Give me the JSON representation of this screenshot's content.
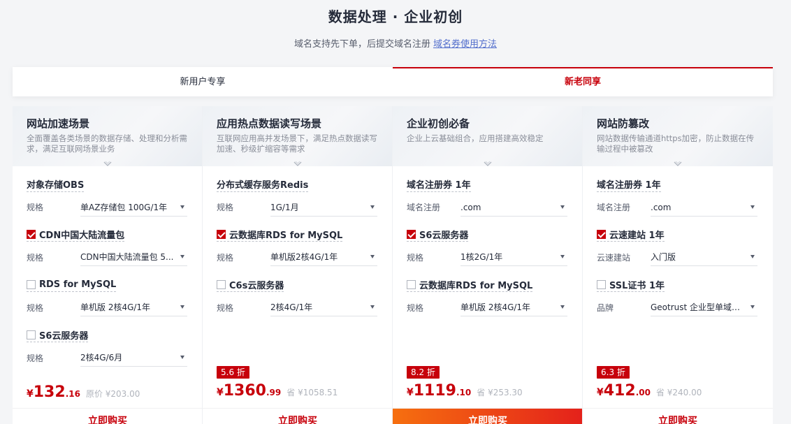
{
  "header": {
    "title": "数据处理 · 企业初创",
    "subtitle_text": "域名支持先下单，后提交域名注册",
    "subtitle_link": "域名券使用方法"
  },
  "tabs": [
    {
      "label": "新用户专享",
      "active": false
    },
    {
      "label": "新老同享",
      "active": true
    }
  ],
  "cards": [
    {
      "title": "网站加速场景",
      "desc": "全面覆盖各类场景的数据存储、处理和分析需求，满足互联网场景业务",
      "products": [
        {
          "name": "对象存储OBS",
          "checkbox": null,
          "spec_label": "规格",
          "spec_value": "单AZ存储包 100G/1年"
        },
        {
          "name": "CDN中国大陆流量包",
          "checkbox": true,
          "spec_label": "规格",
          "spec_value": "CDN中国大陆流量包 5..."
        },
        {
          "name": "RDS for MySQL",
          "checkbox": false,
          "spec_label": "规格",
          "spec_value": "单机版 2核4G/1年"
        },
        {
          "name": "S6云服务器",
          "checkbox": false,
          "spec_label": "规格",
          "spec_value": "2核4G/6月"
        }
      ],
      "discount": "",
      "price_symbol": "¥",
      "price_int": "132",
      "price_dec": ".16",
      "orig": "原价 ¥203.00",
      "buy": "立即购买",
      "buy_hot": false
    },
    {
      "title": "应用热点数据读写场景",
      "desc": "互联网应用高并发场景下，满足热点数据读写加速、秒级扩缩容等需求",
      "products": [
        {
          "name": "分布式缓存服务Redis",
          "checkbox": null,
          "spec_label": "规格",
          "spec_value": "1G/1月"
        },
        {
          "name": "云数据库RDS for MySQL",
          "checkbox": true,
          "spec_label": "规格",
          "spec_value": "单机版2核4G/1年"
        },
        {
          "name": "C6s云服务器",
          "checkbox": false,
          "spec_label": "规格",
          "spec_value": "2核4G/1年"
        }
      ],
      "discount": "5.6 折",
      "price_symbol": "¥",
      "price_int": "1360",
      "price_dec": ".99",
      "orig": "省 ¥1058.51",
      "buy": "立即购买",
      "buy_hot": false
    },
    {
      "title": "企业初创必备",
      "desc": "企业上云基础组合，应用搭建高效稳定",
      "products": [
        {
          "name": "域名注册券 1年",
          "checkbox": null,
          "spec_label": "域名注册",
          "spec_value": ".com"
        },
        {
          "name": "S6云服务器",
          "checkbox": true,
          "spec_label": "规格",
          "spec_value": "1核2G/1年"
        },
        {
          "name": "云数据库RDS for MySQL",
          "checkbox": false,
          "spec_label": "规格",
          "spec_value": "单机版 2核4G/1年"
        }
      ],
      "discount": "8.2 折",
      "price_symbol": "¥",
      "price_int": "1119",
      "price_dec": ".10",
      "orig": "省 ¥253.30",
      "buy": "立即购买",
      "buy_hot": true
    },
    {
      "title": "网站防篡改",
      "desc": "网站数据传输通道https加密，防止数据在传输过程中被篡改",
      "products": [
        {
          "name": "域名注册券 1年",
          "checkbox": null,
          "spec_label": "域名注册",
          "spec_value": ".com"
        },
        {
          "name": "云速建站 1年",
          "checkbox": true,
          "spec_label": "云速建站",
          "spec_value": "入门版"
        },
        {
          "name": "SSL证书 1年",
          "checkbox": false,
          "spec_label": "品牌",
          "spec_value": "Geotrust 企业型单域名..."
        }
      ],
      "discount": "6.3 折",
      "price_symbol": "¥",
      "price_int": "412",
      "price_dec": ".00",
      "orig": "省 ¥240.00",
      "buy": "立即购买",
      "buy_hot": false
    }
  ]
}
